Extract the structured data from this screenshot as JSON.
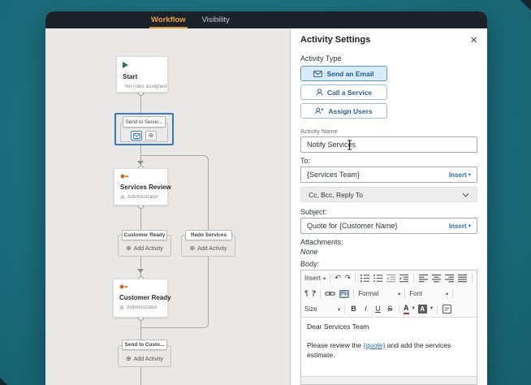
{
  "header": {
    "tabs": [
      {
        "label": "Workflow"
      },
      {
        "label": "Visibility"
      }
    ]
  },
  "icons": {
    "caret_down": "▾",
    "close": "×",
    "plus_circle": "⊕",
    "undo": "↶",
    "redo": "↷",
    "pilcrow": "¶"
  },
  "workflow": {
    "start": {
      "title": "Start",
      "subtitle": "No roles assigned"
    },
    "send_to_services": {
      "label": "Send to Servic..."
    },
    "services_review": {
      "title": "Services Review",
      "subtitle": "Administrator"
    },
    "customer_ready_branch": {
      "label": "Customer Ready",
      "action": "Add Activity"
    },
    "redo_services_branch": {
      "label": "Redo Services",
      "action": "Add Activity"
    },
    "customer_ready": {
      "title": "Customer Ready",
      "subtitle": "Administrator"
    },
    "send_to_customer_branch": {
      "label": "Send to Custo...",
      "action": "Add Activity"
    }
  },
  "panel": {
    "title": "Activity Settings",
    "activity_type": {
      "label": "Activity Type",
      "options": [
        {
          "label": "Send an Email",
          "selected": true
        },
        {
          "label": "Call a Service",
          "selected": false
        },
        {
          "label": "Assign Users",
          "selected": false
        }
      ]
    },
    "activity_name": {
      "label": "Activity Name",
      "value": "Notify Services"
    },
    "to": {
      "label": "To:",
      "value": "{Services Team}",
      "insert": "Insert"
    },
    "cc": {
      "label": "Cc, Bcc, Reply To"
    },
    "subject": {
      "label": "Subject:",
      "value": "Quote for {Customer Name}",
      "insert": "Insert"
    },
    "attachments": {
      "label": "Attachments:",
      "value": "None"
    },
    "body": {
      "label": "Body:",
      "toolbar": {
        "insert": "Insert",
        "format": "Format",
        "font": "Font",
        "size": "Size",
        "bold": "B",
        "italic": "I",
        "underline": "U",
        "strike": "S",
        "color": "A",
        "bgcolor": "A"
      },
      "line1": "Dear Services Team",
      "line2_pre": "Please review the ",
      "line2_link": "{quote}",
      "line2_post": " and add the services estimate."
    }
  },
  "colors": {
    "teal_background": "#1c6e7d",
    "header_dark": "#1c222a",
    "accent_amber": "#e8a33e",
    "accent_blue": "#2f6db8",
    "selection_blue": "#3b78bd",
    "selected_button_bg": "#d9ecfa"
  }
}
